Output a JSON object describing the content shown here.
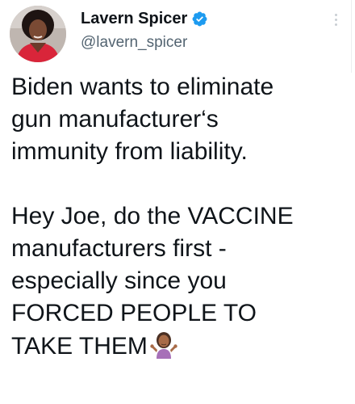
{
  "tweet": {
    "author": {
      "display_name": "Lavern Spicer",
      "handle": "@lavern_spicer",
      "verified": true,
      "avatar_icon": "profile-photo",
      "verified_icon": "verified-badge-icon",
      "verified_color": "#1d9bf0"
    },
    "more_icon": "more-vertical-icon",
    "text": {
      "lines_para1": [
        "Biden wants to eliminate",
        "gun manufacturer‘s",
        "immunity from liability."
      ],
      "lines_para2": [
        "Hey Joe, do the VACCINE",
        "manufacturers first -",
        "especially since you",
        "FORCED PEOPLE TO",
        "TAKE THEM"
      ],
      "trailing_emoji": "person-shrugging-emoji"
    }
  }
}
